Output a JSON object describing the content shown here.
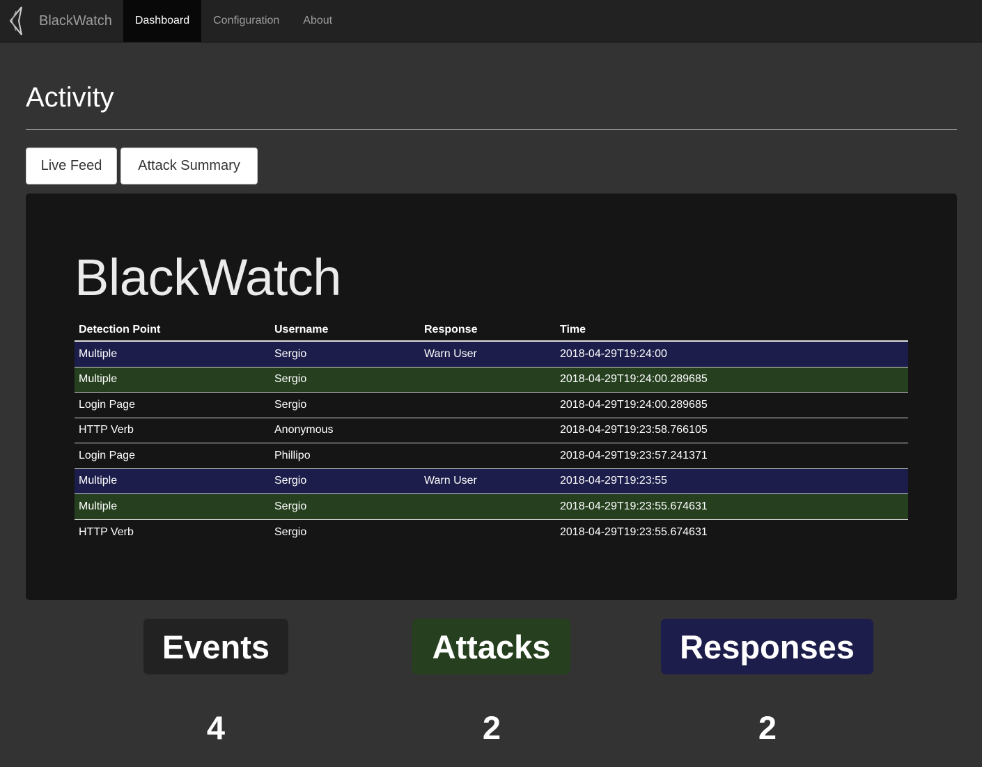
{
  "navbar": {
    "brand": "BlackWatch",
    "logo_icon": "blackwatch-logo-icon",
    "items": [
      {
        "label": "Dashboard",
        "active": true
      },
      {
        "label": "Configuration",
        "active": false
      },
      {
        "label": "About",
        "active": false
      }
    ]
  },
  "header": {
    "title": "Activity"
  },
  "tabs": {
    "live_feed": "Live Feed",
    "attack_summary": "Attack Summary"
  },
  "panel": {
    "title": "BlackWatch",
    "columns": [
      "Detection Point",
      "Username",
      "Response",
      "Time"
    ],
    "rows": [
      {
        "type": "response",
        "detection_point": "Multiple",
        "username": "Sergio",
        "response": "Warn User",
        "time": "2018-04-29T19:24:00"
      },
      {
        "type": "attack",
        "detection_point": "Multiple",
        "username": "Sergio",
        "response": "",
        "time": "2018-04-29T19:24:00.289685"
      },
      {
        "type": "event",
        "detection_point": "Login Page",
        "username": "Sergio",
        "response": "",
        "time": "2018-04-29T19:24:00.289685"
      },
      {
        "type": "event",
        "detection_point": "HTTP Verb",
        "username": "Anonymous",
        "response": "",
        "time": "2018-04-29T19:23:58.766105"
      },
      {
        "type": "event",
        "detection_point": "Login Page",
        "username": "Phillipo",
        "response": "",
        "time": "2018-04-29T19:23:57.241371"
      },
      {
        "type": "response",
        "detection_point": "Multiple",
        "username": "Sergio",
        "response": "Warn User",
        "time": "2018-04-29T19:23:55"
      },
      {
        "type": "attack",
        "detection_point": "Multiple",
        "username": "Sergio",
        "response": "",
        "time": "2018-04-29T19:23:55.674631"
      },
      {
        "type": "event",
        "detection_point": "HTTP Verb",
        "username": "Sergio",
        "response": "",
        "time": "2018-04-29T19:23:55.674631"
      }
    ]
  },
  "summary": {
    "events": {
      "label": "Events",
      "count": "4"
    },
    "attacks": {
      "label": "Attacks",
      "count": "2"
    },
    "responses": {
      "label": "Responses",
      "count": "2"
    }
  },
  "colors": {
    "page_bg": "#333333",
    "navbar_bg": "#222222",
    "panel_bg": "#151515",
    "response_row": "#1c1d4a",
    "attack_row": "#26401f"
  }
}
